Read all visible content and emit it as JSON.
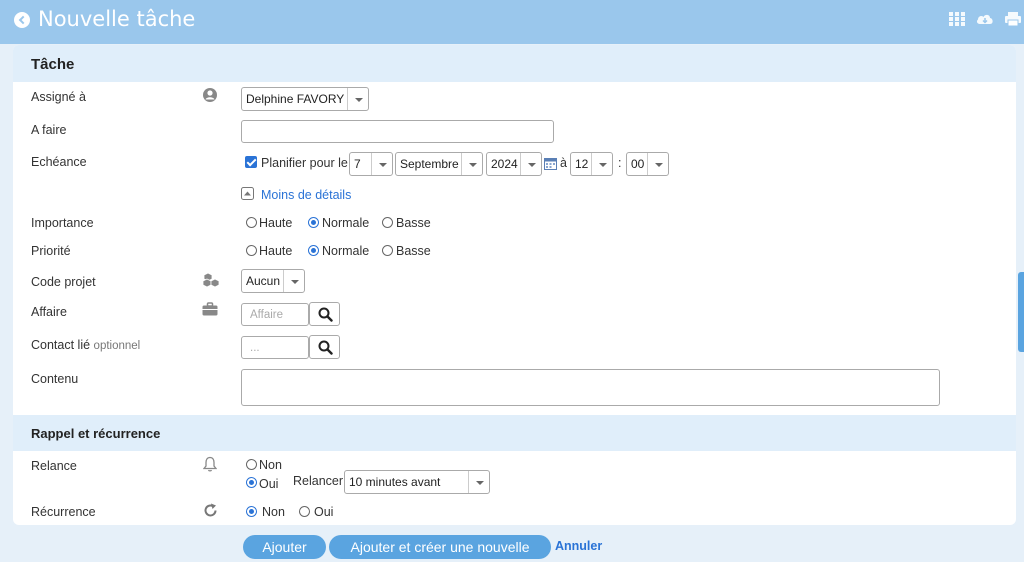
{
  "header": {
    "title": "Nouvelle tâche"
  },
  "sections": {
    "task": "Tâche",
    "reminder": "Rappel et récurrence"
  },
  "fields": {
    "assignee": {
      "label": "Assigné à",
      "value": "Delphine FAVORY"
    },
    "todo": {
      "label": "A faire",
      "value": ""
    },
    "due": {
      "label": "Echéance",
      "plan_label": "Planifier pour le",
      "day": "7",
      "month": "Septembre",
      "year": "2024",
      "at_label": "à",
      "hour": "12",
      "colon": ":",
      "minute": "00",
      "less_details": "Moins de détails"
    },
    "importance": {
      "label": "Importance",
      "options": [
        "Haute",
        "Normale",
        "Basse"
      ],
      "selected": "Normale"
    },
    "priority": {
      "label": "Priorité",
      "options": [
        "Haute",
        "Normale",
        "Basse"
      ],
      "selected": "Normale"
    },
    "project_code": {
      "label": "Code projet",
      "value": "Aucun"
    },
    "affair": {
      "label": "Affaire",
      "placeholder": "Affaire"
    },
    "contact": {
      "label": "Contact lié",
      "optional": "optionnel",
      "placeholder": "..."
    },
    "content": {
      "label": "Contenu",
      "value": ""
    },
    "reminder": {
      "label": "Relance",
      "options": [
        "Non",
        "Oui"
      ],
      "selected": "Oui",
      "remind_label": "Relancer",
      "remind_value": "10 minutes avant"
    },
    "recurrence": {
      "label": "Récurrence",
      "options": [
        "Non",
        "Oui"
      ],
      "selected": "Non"
    }
  },
  "actions": {
    "add": "Ajouter",
    "add_new": "Ajouter et créer une nouvelle",
    "cancel": "Annuler"
  },
  "colors": {
    "header": "#9ac7ec",
    "accent": "#2a73d6",
    "button": "#5aa4e0",
    "section": "#e0eefa",
    "background": "#e6f0f9"
  },
  "icons": [
    "back-icon",
    "grid-icon",
    "cloud-icon",
    "print-icon",
    "user-icon",
    "cubes-icon",
    "briefcase-icon",
    "bell-icon",
    "refresh-icon",
    "calendar-icon",
    "collapse-icon",
    "search-icon"
  ]
}
